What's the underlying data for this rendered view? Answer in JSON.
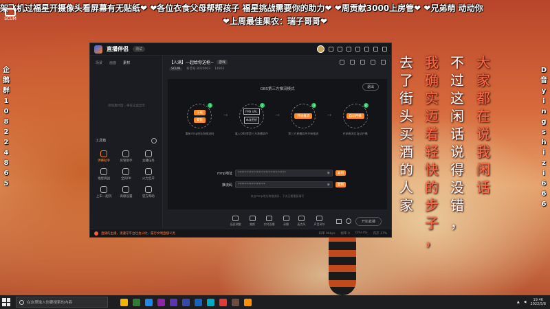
{
  "danmaku": {
    "line1": "架飞机过福星开摄像头看屏幕有无贴纸❤  ❤各位衣食父母帮帮孩子 福星挑战需要你的助力❤ ❤周贡献3000上房管❤ ❤兄弟萌 动动你",
    "line2": "❤上周最佳果农：瑞子哥哥❤"
  },
  "corner_logo": "SCUM",
  "left_column": [
    "企",
    "鹅",
    "群",
    "1",
    "0",
    "8",
    "2",
    "2",
    "4",
    "8",
    "6",
    "5"
  ],
  "right_column": [
    "D",
    "音",
    "y",
    "i",
    "n",
    "g",
    "s",
    "h",
    "i",
    "z",
    "i",
    "6",
    "6",
    "6"
  ],
  "calligraphy": [
    {
      "text": "大家都在说我闲话",
      "color": "#ff6b4a"
    },
    {
      "text": "不过这闲话说得没错，",
      "color": "#ffffff"
    },
    {
      "text": "我确实迈着轻快的步子，",
      "color": "#ff6b4a"
    },
    {
      "text": "去了街头买酒的人家",
      "color": "#ffffff"
    }
  ],
  "app": {
    "name": "直播伴侣",
    "version": "测试",
    "sidebar_tabs": [
      "场景",
      "画面",
      "素材"
    ],
    "empty_hint": "添加素材后，将在这里显示",
    "tools_title": "工具箱",
    "tools": [
      {
        "label": "弹幕助手",
        "icon": "danmaku-icon",
        "active": true
      },
      {
        "label": "房管助手",
        "icon": "user-icon",
        "active": false
      },
      {
        "label": "主播任务",
        "icon": "task-icon",
        "active": false
      },
      {
        "label": "福星挑战",
        "icon": "shield-icon",
        "active": false
      },
      {
        "label": "全民PK",
        "icon": "pk-icon",
        "active": false
      },
      {
        "label": "火力全开",
        "icon": "fire-icon",
        "active": false
      },
      {
        "label": "上车一起玩",
        "icon": "car-icon",
        "active": false
      },
      {
        "label": "高级设置",
        "icon": "settings-icon",
        "active": false
      },
      {
        "label": "官方帮助",
        "icon": "help-icon",
        "active": false
      }
    ],
    "room_title": "【人满】一起给你送枪~",
    "room_tag": "游戏",
    "game_tag": "SCUM",
    "meta_text": "抖音号 8020003",
    "meta_count": "14863",
    "obs_title": "OBS第三方推流模式",
    "exit_label": "退出",
    "steps": [
      {
        "buttons": [
          "下载",
          "安装"
        ],
        "desc": "重新rtmp地址和推流码"
      },
      {
        "buttons": [
          "FMS URL",
          "串流密钥"
        ],
        "desc": "填入OBS等第三方直播软件"
      },
      {
        "buttons": [
          "开始推流"
        ],
        "desc": "第三方直播软件开始推流"
      },
      {
        "buttons": [
          "自动开播"
        ],
        "desc": "开始推流后自动开播"
      }
    ],
    "rtmp_label": "rtmp地址",
    "rtmp_value": "****************************",
    "key_label": "推流码",
    "key_value": "****************",
    "copy_label": "复制",
    "field_hint": "来自rtmp地址和推流码，下次无需重复填写",
    "bottom_tools": [
      "画面调整",
      "美颜",
      "实时直播",
      "录播",
      "麦克风",
      "声音调节"
    ],
    "start_label": "开始直播",
    "status_warning": "直播的主播，请遵守平台社会公约，履行文明直播义务",
    "stats": [
      "码率 0kbps",
      "帧率 0",
      "CPU 4%",
      "内存 37%"
    ]
  },
  "taskbar": {
    "search_placeholder": "在这里输入你要搜索的内容",
    "time": "19:46",
    "date": "2022/5/8",
    "app_colors": [
      "#f4b400",
      "#2e7d32",
      "#1e88e5",
      "#8e24aa",
      "#5e35b1",
      "#3949ab",
      "#1565c0",
      "#00acc1",
      "#e53935",
      "#6d4c41",
      "#ff8f00"
    ]
  }
}
